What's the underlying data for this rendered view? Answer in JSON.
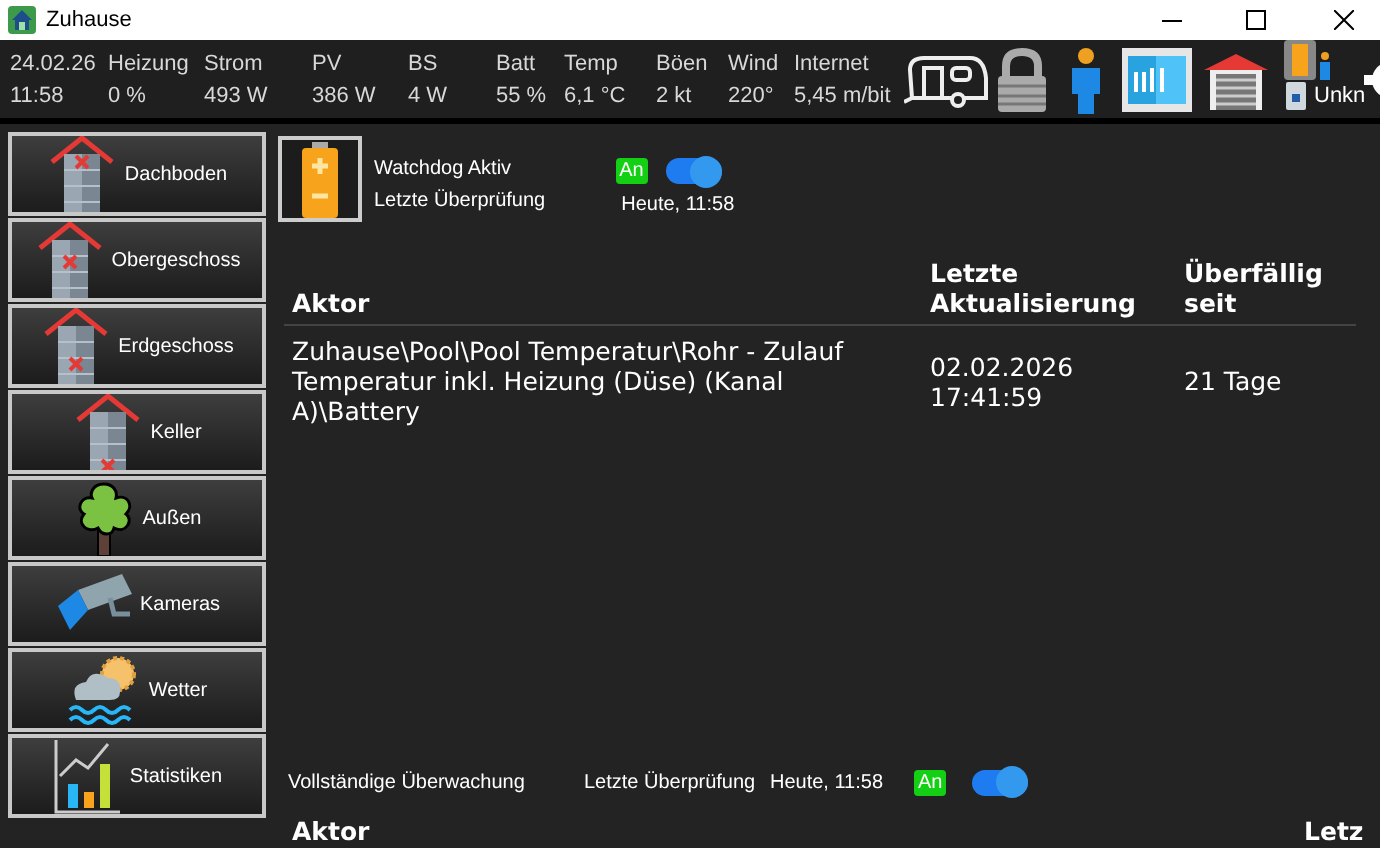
{
  "window": {
    "title": "Zuhause"
  },
  "status_bar": {
    "date": "24.02.26",
    "time": "11:58",
    "readings": [
      {
        "label": "Heizung",
        "value": "0 %"
      },
      {
        "label": "Strom",
        "value": "493 W"
      },
      {
        "label": "PV",
        "value": "386 W"
      },
      {
        "label": "BS",
        "value": "4 W"
      },
      {
        "label": "Batt",
        "value": "55 %"
      },
      {
        "label": "Temp",
        "value": "6,1 °C"
      },
      {
        "label": "Böen",
        "value": "2 kt"
      },
      {
        "label": "Wind",
        "value": "220°"
      },
      {
        "label": "Internet",
        "value": "5,45 m/bit"
      }
    ],
    "device_label": "Unkn"
  },
  "sidebar": {
    "items": [
      {
        "label": "Dachboden",
        "kind": "attic"
      },
      {
        "label": "Obergeschoss",
        "kind": "upper"
      },
      {
        "label": "Erdgeschoss",
        "kind": "ground"
      },
      {
        "label": "Keller",
        "kind": "cellar"
      },
      {
        "label": "Außen",
        "kind": "outdoor"
      },
      {
        "label": "Kameras",
        "kind": "cameras"
      },
      {
        "label": "Wetter",
        "kind": "weather"
      },
      {
        "label": "Statistiken",
        "kind": "statistics"
      }
    ]
  },
  "watchdog": {
    "title": "Watchdog Aktiv",
    "last_check_label": "Letzte Überprüfung",
    "last_check": "Heute, 11:58",
    "badge": "An",
    "on": true
  },
  "table": {
    "columns": [
      "Aktor",
      "Letzte Aktualisierung",
      "Überfällig seit"
    ],
    "rows": [
      {
        "cells": [
          "Zuhause\\Pool\\Pool Temperatur\\Rohr - Zulauf Temperatur inkl. Heizung (Düse) (Kanal A)\\Battery",
          "02.02.2026 17:41:59",
          "21 Tage"
        ]
      }
    ]
  },
  "full_monitoring": {
    "title": "Vollständige Überwachung",
    "last_check_label": "Letzte Überprüfung",
    "last_check": "Heute, 11:58",
    "badge": "An",
    "on": true
  },
  "table_2": {
    "columns": [
      "Aktor",
      "Letz"
    ]
  }
}
